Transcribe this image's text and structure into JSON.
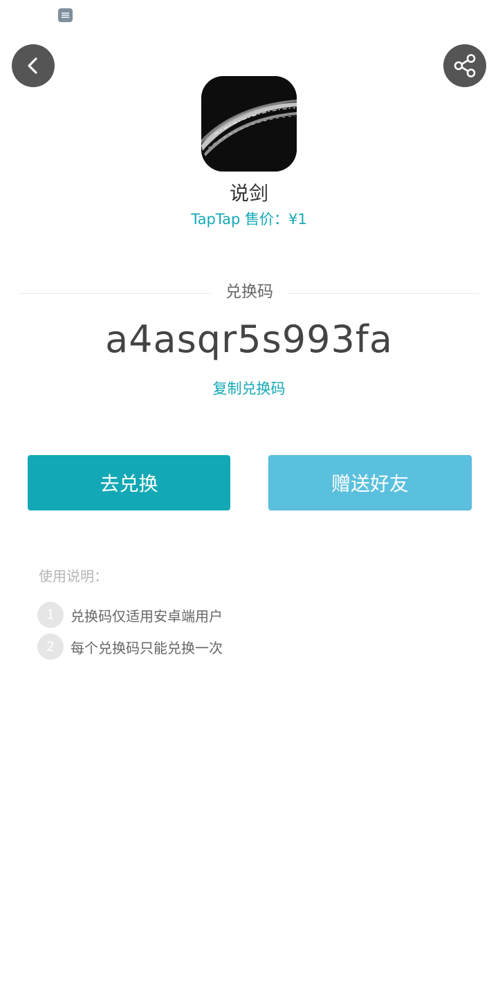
{
  "status_bar": {
    "icons": [
      "notification-icon"
    ]
  },
  "header": {
    "back_icon": "chevron-left-icon",
    "share_icon": "share-icon"
  },
  "app": {
    "name": "说剑",
    "price": "TapTap 售价：¥1"
  },
  "code_section": {
    "label": "兑换码",
    "code": "a4asqr5s993fa",
    "copy_label": "复制兑换码"
  },
  "actions": {
    "redeem_label": "去兑换",
    "gift_label": "赠送好友"
  },
  "instructions": {
    "title": "使用说明：",
    "items": [
      {
        "number": "1",
        "text": "兑换码仅适用安卓端用户"
      },
      {
        "number": "2",
        "text": "每个兑换码只能兑换一次"
      }
    ]
  },
  "colors": {
    "accent": "#14a9b7",
    "primary_button": "#13a8b5",
    "secondary_button": "#5bc0de"
  }
}
